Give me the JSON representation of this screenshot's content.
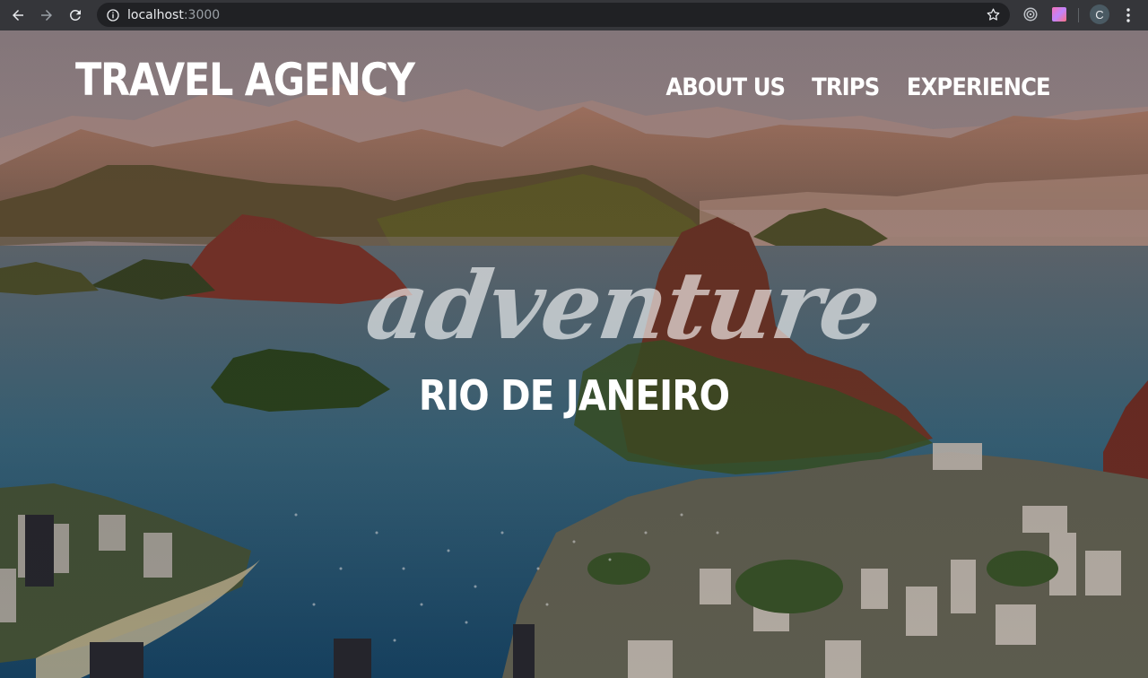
{
  "browser": {
    "url_host": "localhost",
    "url_port": ":3000",
    "profile_initial": "C"
  },
  "header": {
    "brand": "TRAVEL AGENCY",
    "nav": [
      {
        "label": "ABOUT US"
      },
      {
        "label": "TRIPS"
      },
      {
        "label": "EXPERIENCE"
      }
    ]
  },
  "hero": {
    "script_text": "adventure",
    "city": "RIO DE JANEIRO",
    "image_icon": "rio-de-janeiro-landscape-photo"
  },
  "colors": {
    "chrome_bg": "#35363a",
    "omnibox_bg": "#202124",
    "hero_text": "#ffffff"
  }
}
